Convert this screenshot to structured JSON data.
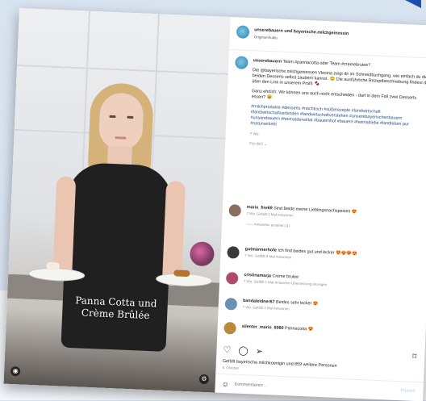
{
  "video": {
    "caption_line1": "Panna Cotta und",
    "caption_line2": "Crème Brûlée",
    "icons": [
      "audio-icon",
      "settings-icon"
    ]
  },
  "header": {
    "username": "unserebauern und bayerische.milchgeinessin",
    "subtitle": "Original-Audio"
  },
  "post": {
    "author": "unserebauern",
    "line1": "Team #pannacotta oder Team #cremebrulee?",
    "line2": "Die @bayerische.milchgeniessen Vlesina zeigt dir im Schneidbuchgang, wie einfach du die beiden Desserts selbst zaubern kannst. 😊 Die ausführliche Rezeptbeschreibung findest du über den Link in unserem Profil. 🍫",
    "line3": "Ganz ehrlich: Wir können uns auch nicht entscheiden - darf in dem Fall zwei Desserts essen? 😄",
    "hashtags": "#milchprodukte #desserts #nachtisch #süßerezepte #landwirtschaft #landwirtschaftverbinden #landwirtschaftverstehen #unserebayerischenbauern #unserebauern #heimatderwiltat #bauernhof #bauern #heimatliebe #landleben pur #naturverliebt",
    "time": "7 Wo.",
    "more": "Für dich ⌄"
  },
  "comments": [
    {
      "user": "marie_fire69",
      "text": "Sind Beide meine Lieblingsnachspeisen 😍",
      "meta": "7 Wo.   Gefällt 3 Mal   Antworten",
      "sub": "—— Antworten ansehen (1)",
      "color": "#8a6d5a"
    },
    {
      "user": "gutmännerhofe",
      "text": "Ich find beides gut und lecker 😍😍😍😍",
      "meta": "7 Wo.   Gefällt 4 Mal   Antworten",
      "sub": "",
      "color": "#3a3a3a"
    },
    {
      "user": "cristinamarja",
      "text": "Creme brulee",
      "meta": "7 Wo.   Gefällt 1 Mal   Antworten   Übersetzung anzeigen",
      "sub": "",
      "color": "#b04a6a"
    },
    {
      "user": "bandaleidner67",
      "text": "Beides sehr lecker 😍",
      "meta": "7 Wo.   Gefällt 3 Mal   Antworten",
      "sub": "",
      "color": "#6c8fb5"
    },
    {
      "user": "silenter_mario_6980",
      "text": "Pannacotta 😍",
      "meta": "",
      "sub": "",
      "color": "#b88a3c"
    }
  ],
  "footer": {
    "likes": "Gefällt bayerische.milchkoenigin und 859 weitere Personen",
    "date": "5. Oktober",
    "add_comment_placeholder": "Kommentieren ...",
    "post_label": "Posten"
  },
  "colors": {
    "accent": "#0095f6",
    "hashtag": "#2b4e8a",
    "background": "#d8e3f0"
  }
}
